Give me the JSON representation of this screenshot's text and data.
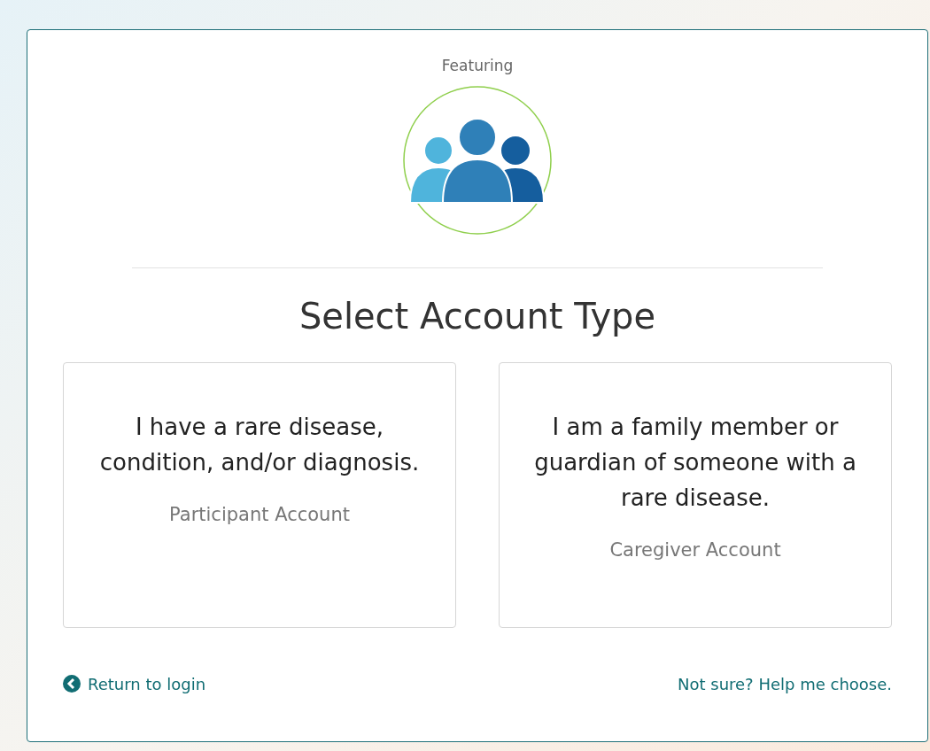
{
  "header": {
    "kicker": "Featuring"
  },
  "title": "Select Account Type",
  "options": [
    {
      "description": "I have a rare disease, condition, and/or diagnosis.",
      "label": "Participant Account"
    },
    {
      "description": "I am a family member or guardian of someone with a rare disease.",
      "label": "Caregiver Account"
    }
  ],
  "footer": {
    "back_link": "Return to login",
    "help_link": "Not sure? Help me choose."
  }
}
